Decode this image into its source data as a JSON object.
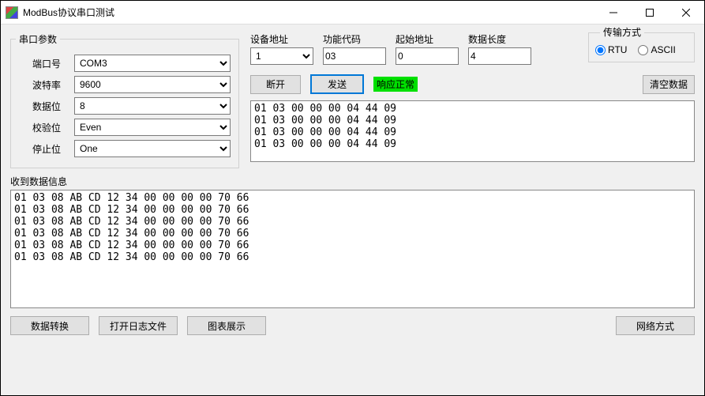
{
  "window": {
    "title": "ModBus协议串口测试"
  },
  "serial": {
    "legend": "串口参数",
    "port_label": "端口号",
    "port_value": "COM3",
    "baud_label": "波特率",
    "baud_value": "9600",
    "databits_label": "数据位",
    "databits_value": "8",
    "parity_label": "校验位",
    "parity_value": "Even",
    "stopbits_label": "停止位",
    "stopbits_value": "One"
  },
  "fields": {
    "device_addr_label": "设备地址",
    "device_addr_value": "1",
    "func_code_label": "功能代码",
    "func_code_value": "03",
    "start_addr_label": "起始地址",
    "start_addr_value": "0",
    "data_len_label": "数据长度",
    "data_len_value": "4"
  },
  "transfer": {
    "legend": "传输方式",
    "rtu_label": "RTU",
    "ascii_label": "ASCII",
    "selected": "RTU"
  },
  "actions": {
    "disconnect": "断开",
    "send": "发送",
    "status_text": "响应正常",
    "clear": "清空数据"
  },
  "send_log": "01 03 00 00 00 04 44 09\n01 03 00 00 00 04 44 09\n01 03 00 00 00 04 44 09\n01 03 00 00 00 04 44 09",
  "recv": {
    "label": "收到数据信息",
    "log": "01 03 08 AB CD 12 34 00 00 00 00 70 66\n01 03 08 AB CD 12 34 00 00 00 00 70 66\n01 03 08 AB CD 12 34 00 00 00 00 70 66\n01 03 08 AB CD 12 34 00 00 00 00 70 66\n01 03 08 AB CD 12 34 00 00 00 00 70 66\n01 03 08 AB CD 12 34 00 00 00 00 70 66"
  },
  "bottom": {
    "convert": "数据转换",
    "open_log": "打开日志文件",
    "chart": "图表展示",
    "network": "网络方式"
  }
}
